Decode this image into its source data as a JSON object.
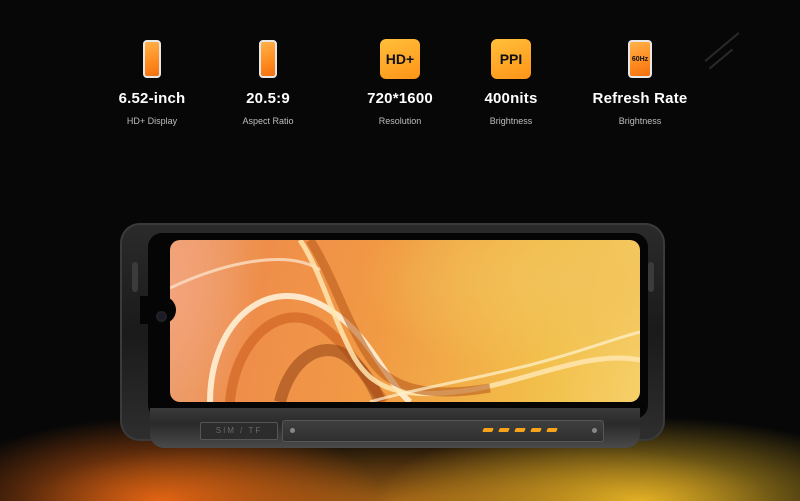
{
  "specs": [
    {
      "value": "6.52-inch",
      "label": "HD+ Display",
      "icon": "phone-icon"
    },
    {
      "value": "20.5:9",
      "label": "Aspect Ratio",
      "icon": "phone-icon"
    },
    {
      "value": "720*1600",
      "label": "Resolution",
      "icon": "hd-plus-badge-icon",
      "badge": "HD+"
    },
    {
      "value": "400nits",
      "label": "Brightness",
      "icon": "ppi-badge-icon",
      "badge": "PPI"
    },
    {
      "value": "Refresh Rate",
      "label": "Brightness",
      "icon": "refresh-rate-icon",
      "badge": "60Hz"
    }
  ],
  "phone": {
    "sim_tray_text": "SIM / TF"
  },
  "colors": {
    "background": "#070707",
    "accent_orange": "#ff8a1e",
    "accent_yellow": "#ffbf3a"
  }
}
